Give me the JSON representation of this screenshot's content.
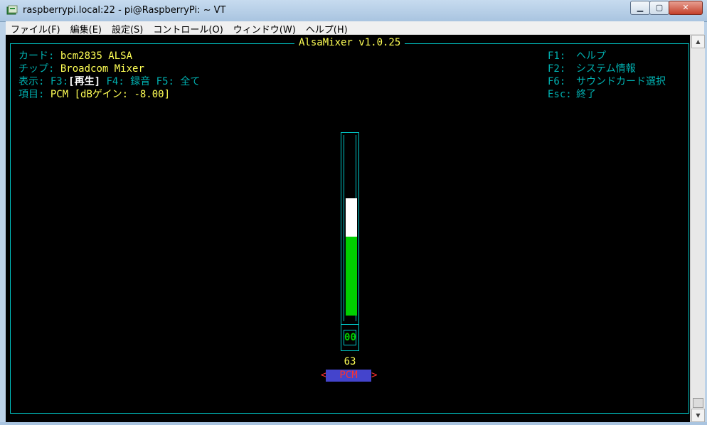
{
  "window": {
    "title": "raspberrypi.local:22 - pi@RaspberryPi: ~ VT",
    "min_glyph": "▁",
    "max_glyph": "▢",
    "close_glyph": "✕"
  },
  "menu": [
    "ファイル(F)",
    "編集(E)",
    "設定(S)",
    "コントロール(O)",
    "ウィンドウ(W)",
    "ヘルプ(H)"
  ],
  "alsamixer": {
    "title": "AlsaMixer v1.0.25",
    "card_label": "カード:",
    "card_value": "bcm2835 ALSA",
    "chip_label": "チップ:",
    "chip_value": "Broadcom Mixer",
    "view_label": "表示:",
    "view_f3": "F3:",
    "view_f3_value": "[再生]",
    "view_f4": "F4:",
    "view_f4_value": "録音",
    "view_f5": "F5:",
    "view_f5_value": "全て",
    "item_label": "項目:",
    "item_value": "PCM [dBゲイン: -8.00]",
    "help": [
      {
        "key": "F1:",
        "text": "ヘルプ"
      },
      {
        "key": "F2:",
        "text": "システム情報"
      },
      {
        "key": "F6:",
        "text": "サウンドカード選択"
      },
      {
        "key": "Esc:",
        "text": "終了"
      }
    ],
    "control": {
      "name": "PCM",
      "level": "63",
      "level_fraction": 0.63,
      "switch": "00",
      "left_arrow": "<",
      "right_arrow": ">"
    }
  },
  "colors": {
    "frame": "#00c8c8",
    "label": "#00b0b0",
    "value": "#ffff55",
    "bar_green": "#00d000",
    "bar_white": "#ffffff",
    "name_bg": "#4444cc",
    "name_text": "#ff3030"
  }
}
